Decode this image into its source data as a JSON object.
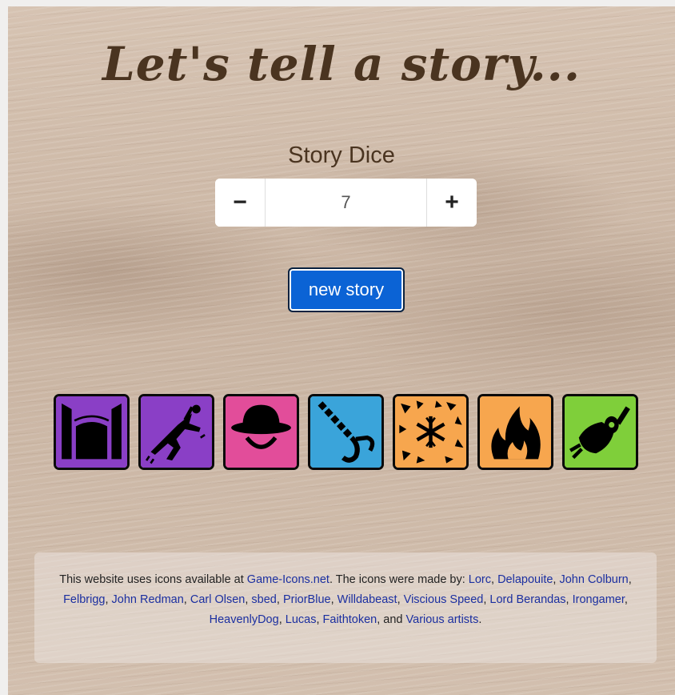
{
  "header": {
    "title": "Let's tell a story...",
    "subtitle": "Story Dice"
  },
  "stepper": {
    "minus_label": "−",
    "value": "7",
    "plus_label": "+"
  },
  "actions": {
    "new_story_label": "new story"
  },
  "dice": [
    {
      "icon": "gate-icon",
      "color": "#8a3fc6"
    },
    {
      "icon": "falling-man-icon",
      "color": "#8a3fc6"
    },
    {
      "icon": "hat-face-icon",
      "color": "#e24d9a"
    },
    {
      "icon": "chain-hook-icon",
      "color": "#3aa4da"
    },
    {
      "icon": "snowflake-shards-icon",
      "color": "#f7a64e"
    },
    {
      "icon": "flame-icon",
      "color": "#f7a64e"
    },
    {
      "icon": "meat-skewer-icon",
      "color": "#7fcf3a"
    }
  ],
  "colors": {
    "title": "#4a3420",
    "button": "#0b63d5",
    "link": "#1b2fa0"
  },
  "credits": {
    "intro": "This website uses icons available at ",
    "site_link": "Game-Icons.net",
    "made_by": ". The icons were made by: ",
    "authors": [
      "Lorc",
      "Delapouite",
      "John Colburn",
      "Felbrigg",
      "John Redman",
      "Carl Olsen",
      "sbed",
      "PriorBlue",
      "Willdabeast",
      "Viscious Speed",
      "Lord Berandas",
      "Irongamer",
      "HeavenlyDog",
      "Lucas",
      "Faithtoken"
    ],
    "and_text": ", and ",
    "last_link": "Various artists",
    "end": "."
  }
}
